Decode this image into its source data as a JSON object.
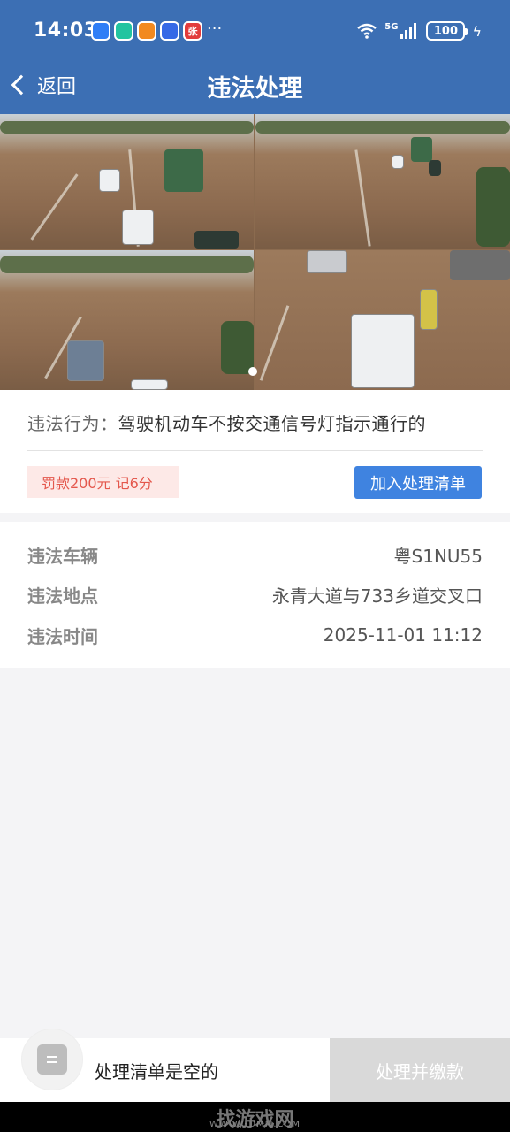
{
  "status_bar": {
    "time": "14:03",
    "more": "···",
    "network": "5G",
    "battery": "100",
    "app_icons": [
      {
        "name": "app-icon-1",
        "color": "#2f7ef6",
        "glyph": ""
      },
      {
        "name": "app-icon-2",
        "color": "#22c4a0",
        "glyph": ""
      },
      {
        "name": "app-icon-3",
        "color": "#f28a20",
        "glyph": ""
      },
      {
        "name": "app-icon-4",
        "color": "#3569e6",
        "glyph": ""
      },
      {
        "name": "app-icon-5",
        "color": "#e23b3b",
        "glyph": "张"
      }
    ]
  },
  "nav": {
    "back_label": "返回",
    "title": "违法处理"
  },
  "colors": {
    "header": "#3c6fb4",
    "primary_button": "#3f83e0",
    "penalty_text": "#e4574c",
    "penalty_bg": "#fde9e7"
  },
  "gallery": {
    "image_count": 4,
    "active_dot": 1
  },
  "violation": {
    "label": "违法行为：",
    "description": "驾驶机动车不按交通信号灯指示通行的",
    "penalty": "罚款200元 记6分",
    "add_button": "加入处理清单"
  },
  "details": [
    {
      "label": "违法车辆",
      "value": "粤S1NU55"
    },
    {
      "label": "违法地点",
      "value": "永青大道与733乡道交叉口"
    },
    {
      "label": "违法时间",
      "value": "2025-11-01 11:12"
    }
  ],
  "bottom": {
    "empty_text": "处理清单是空的",
    "pay_button": "处理并缴款"
  },
  "watermark": {
    "text": "找游戏网",
    "url": "WWW.GDMM.COM"
  }
}
